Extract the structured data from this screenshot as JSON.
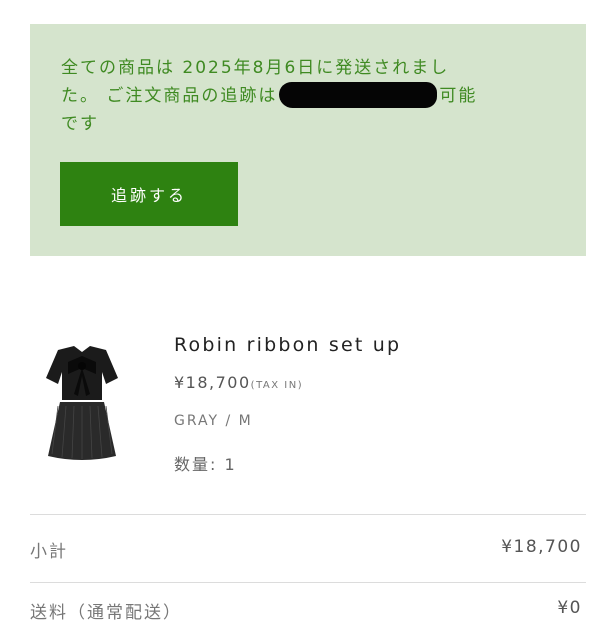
{
  "notice": {
    "line1": "全ての商品は 2025年8月6日に発送されまし",
    "line2_before": "た。 ご注文商品の追跡は",
    "line2_after": "可能",
    "line3": "です",
    "track_button_label": "追跡する"
  },
  "product": {
    "name": "Robin ribbon set up",
    "price": "¥18,700",
    "tax_note": "(TAX IN)",
    "variant": "GRAY / M",
    "quantity": "数量: 1"
  },
  "summary": {
    "subtotal_label": "小計",
    "subtotal_value": "¥18,700",
    "shipping_label": "送料（通常配送）",
    "shipping_value": "¥0"
  }
}
